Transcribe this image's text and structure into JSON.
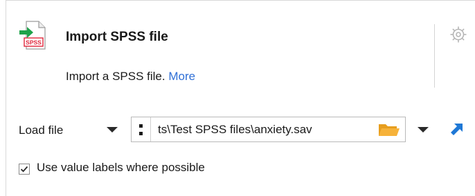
{
  "analysis": {
    "title": "Import SPSS file",
    "description": "Import a SPSS file.",
    "more_link": "More",
    "icon": "spss-file-icon",
    "settings_icon": "gear-icon"
  },
  "load": {
    "label": "Load file",
    "path_value": "ts\\Test SPSS files\\anxiety.sav",
    "browse_icon": "folder-icon",
    "jump_icon": "arrow-up-right-icon"
  },
  "options": {
    "use_value_labels": {
      "label": "Use value labels where possible",
      "checked": true
    }
  },
  "colors": {
    "link": "#2f6fd6",
    "arrow_green": "#1fa34a",
    "spss_red": "#e0253a",
    "folder": "#f6b23a",
    "jump_blue": "#1e78d6"
  }
}
